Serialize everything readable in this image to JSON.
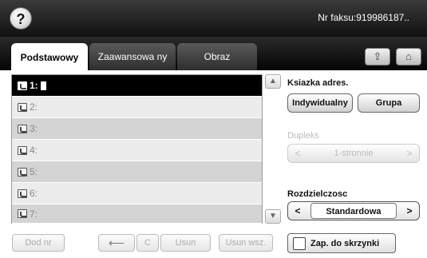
{
  "header": {
    "help_glyph": "?",
    "fax_number": "Nr faksu:919986187.."
  },
  "tabs": [
    {
      "label": "Podstawowy",
      "active": true
    },
    {
      "label": "Zaawansowa ny",
      "active": false
    },
    {
      "label": "Obraz",
      "active": false
    }
  ],
  "toolbar": {
    "forward_icon": "tray-forward-icon",
    "home_icon": "home-icon"
  },
  "number_list": {
    "rows": [
      {
        "label": "1:",
        "selected": true
      },
      {
        "label": "2:",
        "selected": false
      },
      {
        "label": "3:",
        "selected": false
      },
      {
        "label": "4:",
        "selected": false
      },
      {
        "label": "5:",
        "selected": false
      },
      {
        "label": "6:",
        "selected": false
      },
      {
        "label": "7:",
        "selected": false
      }
    ]
  },
  "bottom_buttons": {
    "add_number": "Dod nr",
    "backspace": "⟵",
    "clear": "C",
    "delete": "Usun",
    "delete_all": "Usun wsz."
  },
  "address_book": {
    "label": "Ksiazka adres.",
    "individual": "Indywidualny",
    "group": "Grupa"
  },
  "duplex": {
    "label": "Dupleks",
    "value": "1-stronnie",
    "enabled": false
  },
  "resolution": {
    "label": "Rozdzielczosc",
    "value": "Standardowa"
  },
  "save_to_inbox": {
    "label": "Zap. do skrzynki",
    "checked": false
  },
  "colors": {
    "topbar": "#111111",
    "selected_row": "#000000",
    "row_light": "#ececec",
    "row_dark": "#d4d4d4"
  }
}
